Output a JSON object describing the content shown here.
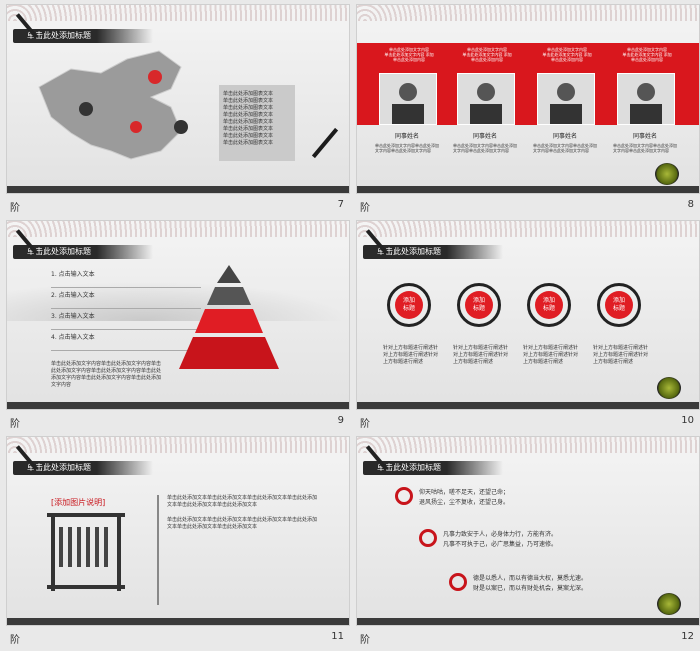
{
  "title_bar": "单击此处添加标题",
  "footer_left": "阶",
  "slides": {
    "s7": {
      "number": "7",
      "map_labels": [
        "单击此处添加图表文本",
        "单击此处添加图表文本",
        "单击此处添加图表文本",
        "单击此处添加图表文本",
        "单击此处添加图表文本",
        "单击此处添加图表文本",
        "单击此处添加图表文本",
        "单击此处添加图表文本"
      ]
    },
    "s8": {
      "number": "8",
      "people": [
        {
          "caption": "单击此处添加文字内容\n单击此处添加文字内容 添加\n单击此处添加内容",
          "name": "同事姓名",
          "desc": "单击此处添加文字内容单击此处添加文字内容单击此处添加文字内容"
        },
        {
          "caption": "单击此处添加文字内容\n单击此处添加文字内容 添加\n单击此处添加内容",
          "name": "同事姓名",
          "desc": "单击此处添加文字内容单击此处添加文字内容单击此处添加文字内容"
        },
        {
          "caption": "单击此处添加文字内容\n单击此处添加文字内容 添加\n单击此处添加内容",
          "name": "同事姓名",
          "desc": "单击此处添加文字内容单击此处添加文字内容单击此处添加文字内容"
        },
        {
          "caption": "单击此处添加文字内容\n单击此处添加文字内容 添加\n单击此处添加内容",
          "name": "同事姓名",
          "desc": "单击此处添加文字内容单击此处添加文字内容单击此处添加文字内容"
        }
      ]
    },
    "s9": {
      "number": "9",
      "items": [
        "1. 点击输入文本",
        "2. 点击输入文本",
        "3. 点击输入文本",
        "4. 点击输入文本"
      ],
      "paragraph": "单击此处添加文字内容单击此处添加文字内容单击此处添加文字内容单击此处添加文字内容单击此处添加文字内容单击此处添加文字内容单击此处添加文字内容"
    },
    "s10": {
      "number": "10",
      "circles": [
        {
          "label1": "添加",
          "label2": "标题",
          "text": "针对上方标题进行阐述针对上方标题进行阐述针对上方标题进行阐述"
        },
        {
          "label1": "添加",
          "label2": "标题",
          "text": "针对上方标题进行阐述针对上方标题进行阐述针对上方标题进行阐述"
        },
        {
          "label1": "添加",
          "label2": "标题",
          "text": "针对上方标题进行阐述针对上方标题进行阐述针对上方标题进行阐述"
        },
        {
          "label1": "添加",
          "label2": "标题",
          "text": "针对上方标题进行阐述针对上方标题进行阐述针对上方标题进行阐述"
        }
      ]
    },
    "s11": {
      "number": "11",
      "caption": "[添加图片说明]",
      "bullets": [
        "单击此处添加文本单击此处添加文本单击此处添加文本单击此处添加文本单击此处添加文本单击此处添加文本",
        "单击此处添加文本单击此处添加文本单击此处添加文本单击此处添加文本单击此处添加文本单击此处添加文本"
      ]
    },
    "s12": {
      "number": "12",
      "poems": [
        {
          "line1": "仰天咕咕，嗟不足天，还望己命；",
          "line2": "退风扬尘，尘不复收，还望己身。"
        },
        {
          "line1": "凡事力致安于人，必身体力行，方能有济。",
          "line2": "凡事不可执于己，必广思集益，乃可速修。"
        },
        {
          "line1": "德是以悉人，而以有德当大权，莫悉尤速。",
          "line2": "财是以案已，而以有财处机会，莫案尤深。"
        }
      ]
    }
  },
  "colors": {
    "accent": "#e11f26",
    "dark": "#2b2b2b"
  }
}
